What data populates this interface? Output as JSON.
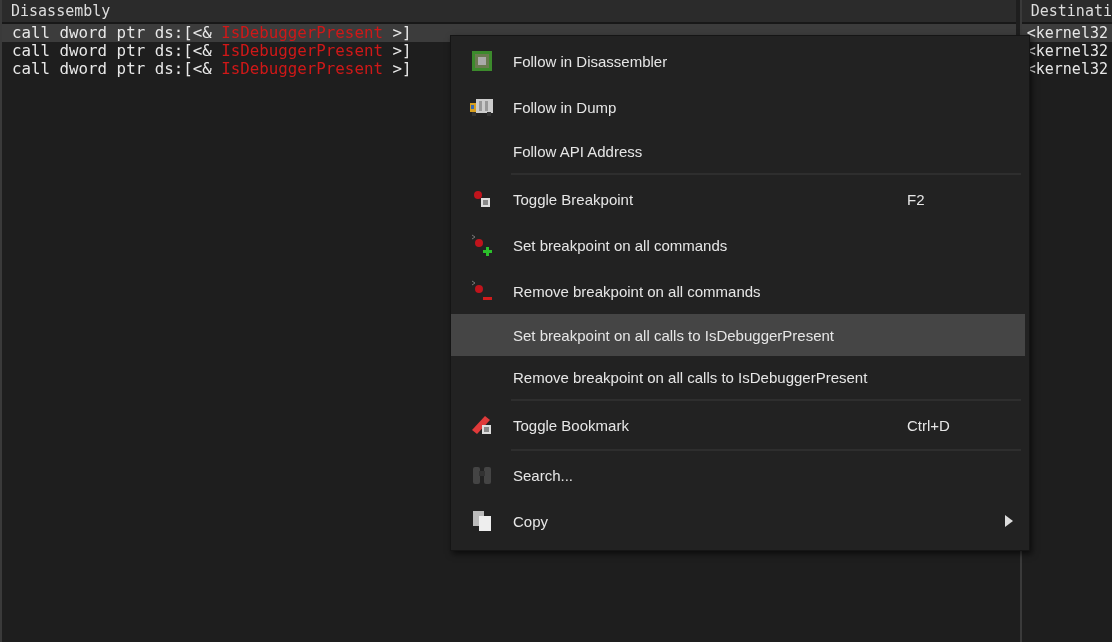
{
  "disassembly": {
    "header": "Disassembly",
    "rows": [
      {
        "prefix": "call dword ptr ds:[<& ",
        "api": "IsDebuggerPresent",
        "suffix": " >]",
        "selected": true
      },
      {
        "prefix": "call dword ptr ds:[<& ",
        "api": "IsDebuggerPresent",
        "suffix": " >]",
        "selected": false
      },
      {
        "prefix": "call dword ptr ds:[<& ",
        "api": "IsDebuggerPresent",
        "suffix": " >]",
        "selected": false
      }
    ]
  },
  "destination": {
    "header": "Destinati",
    "rows": [
      {
        "text": "<kernel32",
        "selected": true
      },
      {
        "text": "<kernel32",
        "selected": false
      },
      {
        "text": "<kernel32",
        "selected": false
      }
    ]
  },
  "context_menu": {
    "items": [
      {
        "kind": "item",
        "label": "Follow in Disassembler",
        "selected": false
      },
      {
        "kind": "item",
        "label": "Follow in Dump",
        "selected": false
      },
      {
        "kind": "item",
        "label": "Follow API Address",
        "selected": false
      },
      {
        "kind": "separator"
      },
      {
        "kind": "item",
        "label": "Toggle Breakpoint",
        "shortcut": "F2",
        "selected": false
      },
      {
        "kind": "item",
        "label": "Set breakpoint on all commands",
        "selected": false
      },
      {
        "kind": "item",
        "label": "Remove breakpoint on all commands",
        "selected": false
      },
      {
        "kind": "item",
        "label": "Set breakpoint on all calls to IsDebuggerPresent",
        "selected": true
      },
      {
        "kind": "item",
        "label": "Remove breakpoint on all calls to IsDebuggerPresent",
        "selected": false
      },
      {
        "kind": "separator"
      },
      {
        "kind": "item",
        "label": "Toggle Bookmark",
        "shortcut": "Ctrl+D",
        "selected": false
      },
      {
        "kind": "separator"
      },
      {
        "kind": "item",
        "label": "Search...",
        "selected": false
      },
      {
        "kind": "item",
        "label": "Copy",
        "submenu": true,
        "selected": false
      }
    ]
  }
}
